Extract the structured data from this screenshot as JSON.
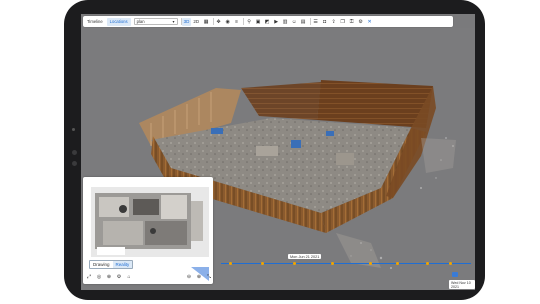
{
  "toolbar": {
    "tabs": [
      {
        "label": "Timeline",
        "active": false
      },
      {
        "label": "Locations",
        "active": true
      }
    ],
    "location_value": "plan",
    "view_modes": [
      {
        "label": "3D",
        "active": true
      },
      {
        "label": "2D",
        "active": false
      }
    ],
    "icons": [
      "calendar-icon",
      "compass-icon",
      "eye-icon",
      "layers-icon",
      "pin-icon",
      "image-icon",
      "photo-icon",
      "video-icon",
      "chart-icon",
      "user-icon",
      "grid-icon",
      "list-icon",
      "camera-icon",
      "share-icon",
      "copy-icon",
      "lock-icon",
      "settings-icon",
      "close-icon"
    ]
  },
  "minimap": {
    "tabs": [
      {
        "label": "Drawing",
        "active": false
      },
      {
        "label": "Reality",
        "active": true
      }
    ]
  },
  "timeline": {
    "tooltip": "Mon Jun 21 2021",
    "date_badge": "Wed Nov 10 2021",
    "accent": "#1f6ed4",
    "marker_color": "#f0a500"
  }
}
